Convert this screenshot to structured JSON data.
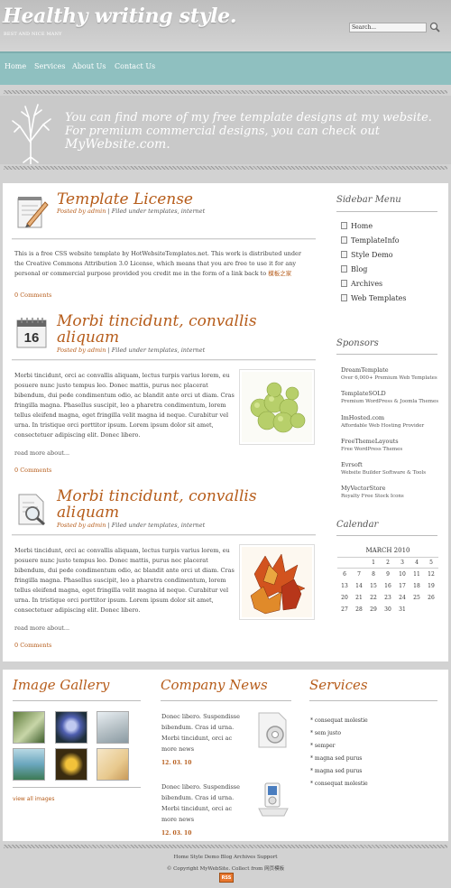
{
  "header": {
    "logo": "Healthy writing style.",
    "tagline": "BEST AND NICE MANY",
    "search_value": "Search..."
  },
  "nav": [
    "Home",
    "Services",
    "About Us",
    "Contact Us"
  ],
  "banner": {
    "line1": "You can find more of my free template designs at my website.",
    "line2": "For premium commercial designs, you can check out",
    "line3": "MyWebsite.com."
  },
  "posts": [
    {
      "title": "Template License",
      "posted_prefix": "Posted by",
      "author": "admin",
      "filed": "| Filed under templates, internet",
      "body": "This is a free CSS website template by HotWebsiteTemplates.net. This work is distributed under the Creative Commons Attribution 3.0 License, which means that you are free to use it for any personal or commercial purpose provided you credit me in the form of a link back to",
      "body_link": "模板之家",
      "comments": "0 Comments"
    },
    {
      "title_line1": "Morbi tincidunt, convallis",
      "title_line2": "aliquam",
      "posted_prefix": "Posted by",
      "author": "admin",
      "filed": "| Filed under templates, internet",
      "body": "Morbi tincidunt, orci ac convallis aliquam, lectus turpis varius lorem, eu posuere nunc justo tempus leo. Donec mattis, purus nec placerat bibendum, dui pede condimentum odio, ac blandit ante orci ut diam. Cras fringilla magna. Phasellus suscipit, leo a pharetra condimentum, lorem tellus eleifend magna, eget fringilla velit magna id neque. Curabitur vel urna. In tristique orci porttitor ipsum. Lorem ipsum dolor sit amet, consectetuer adipiscing elit. Donec libero.",
      "read_more": "read more about...",
      "comments": "0 Comments",
      "calendar_day": "16"
    },
    {
      "title_line1": "Morbi tincidunt, convallis",
      "title_line2": "aliquam",
      "posted_prefix": "Posted by",
      "author": "admin",
      "filed": "| Filed under templates, internet",
      "body": "Morbi tincidunt, orci ac convallis aliquam, lectus turpis varius lorem, eu posuere nunc justo tempus leo. Donec mattis, purus nec placerat bibendum, dui pede condimentum odio, ac blandit ante orci ut diam. Cras fringilla magna. Phasellus suscipit, leo a pharetra condimentum, lorem tellus eleifend magna, eget fringilla velit magna id neque. Curabitur vel urna. In tristique orci porttitor ipsum. Lorem ipsum dolor sit amet, consectetuer adipiscing elit. Donec libero.",
      "read_more": "read more about...",
      "comments": "0 Comments"
    }
  ],
  "sidebar": {
    "menu_title": "Sidebar Menu",
    "menu": [
      "Home",
      "TemplateInfo",
      "Style Demo",
      "Blog",
      "Archives",
      "Web Templates"
    ],
    "sponsors_title": "Sponsors",
    "sponsors": [
      {
        "name": "DreamTemplate",
        "desc": "Over 6,000+ Premium Web Templates"
      },
      {
        "name": "TemplateSOLD",
        "desc": "Premium WordPress & Joomla Themes"
      },
      {
        "name": "ImHosted.com",
        "desc": "Affordable Web Hosting Provider"
      },
      {
        "name": "FreeThemeLayouts",
        "desc": "Free WordPress Themes"
      },
      {
        "name": "Evrsoft",
        "desc": "Website Builder Software & Tools"
      },
      {
        "name": "MyVectorStore",
        "desc": "Royalty Free Stock Icons"
      }
    ],
    "calendar_title": "Calendar",
    "calendar": {
      "caption": "MARCH 2010",
      "rows": [
        [
          "",
          "",
          "1",
          "2",
          "3",
          "4",
          "5"
        ],
        [
          "6",
          "7",
          "8",
          "9",
          "10",
          "11",
          "12"
        ],
        [
          "13",
          "14",
          "15",
          "16",
          "17",
          "18",
          "19"
        ],
        [
          "20",
          "21",
          "22",
          "23",
          "24",
          "25",
          "26"
        ],
        [
          "27",
          "28",
          "29",
          "30",
          "31",
          "",
          ""
        ]
      ]
    }
  },
  "footer": {
    "gallery_title": "Image Gallery",
    "view_all": "view all images",
    "news_title": "Company News",
    "news": [
      {
        "text": "Donec libero. Suspendisse bibendum. Cras id urna. Morbi tincidunt, orci ac",
        "more": "more news",
        "date": "12. 03. 10"
      },
      {
        "text": "Donec libero. Suspendisse bibendum. Cras id urna. Morbi tincidunt, orci ac",
        "more": "more news",
        "date": "12. 03. 10"
      }
    ],
    "services_title": "Services",
    "services": [
      "consequat molestie",
      "sem justo",
      "semper",
      "magna sed purus",
      "magna sed purus",
      "consequat molestie"
    ]
  },
  "bottom": {
    "links": "Home Style Demo Blog Archives Support",
    "copyright": "© Copyright MyWebSite. Collect from 网页模板",
    "rss": "RSS"
  }
}
